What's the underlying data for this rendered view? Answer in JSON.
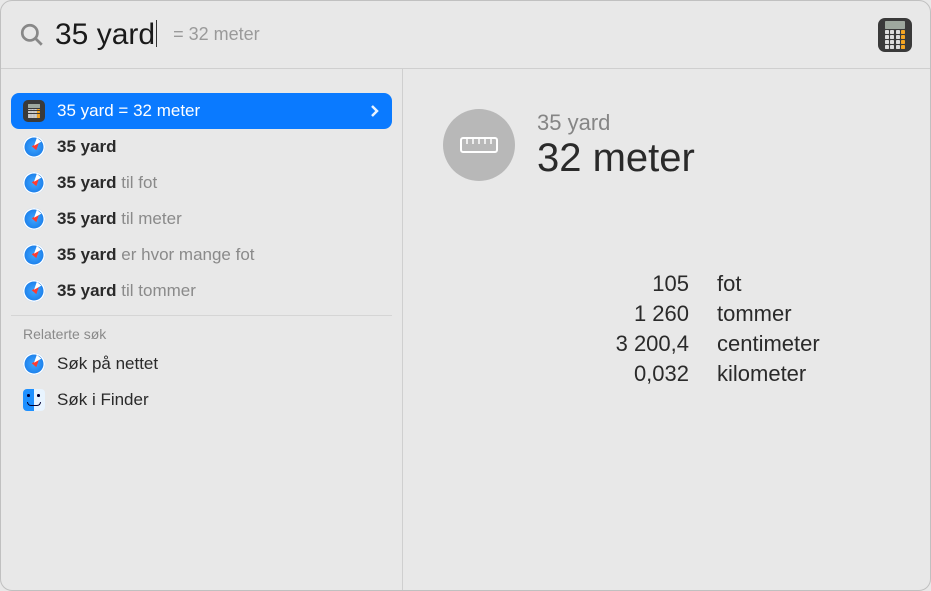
{
  "search": {
    "query": "35 yard",
    "hint": "= 32 meter"
  },
  "results": {
    "primary": {
      "label": "35 yard = 32 meter"
    },
    "suggestions": [
      {
        "bold": "35 yard",
        "rest": ""
      },
      {
        "bold": "35 yard",
        "rest": " til fot"
      },
      {
        "bold": "35 yard",
        "rest": " til meter"
      },
      {
        "bold": "35 yard",
        "rest": " er hvor mange fot"
      },
      {
        "bold": "35 yard",
        "rest": " til tommer"
      }
    ]
  },
  "related": {
    "header": "Relaterte søk",
    "items": [
      {
        "icon": "safari",
        "label": "Søk på nettet"
      },
      {
        "icon": "finder",
        "label": "Søk i Finder"
      }
    ]
  },
  "detail": {
    "subtitle": "35 yard",
    "title": "32 meter",
    "conversions": [
      {
        "value": "105",
        "unit": "fot"
      },
      {
        "value": "1 260",
        "unit": "tommer"
      },
      {
        "value": "3 200,4",
        "unit": "centimeter"
      },
      {
        "value": "0,032",
        "unit": "kilometer"
      }
    ]
  }
}
